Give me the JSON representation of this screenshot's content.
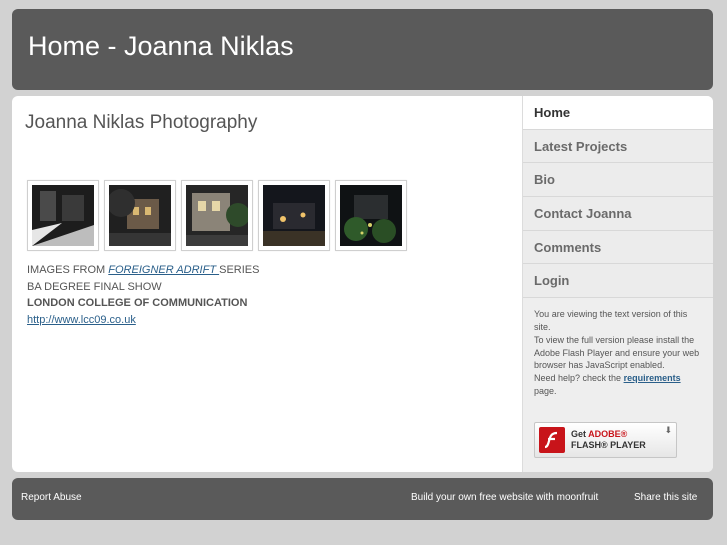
{
  "header": {
    "title": "Home - Joanna Niklas"
  },
  "main": {
    "heading": "Joanna Niklas Photography",
    "thumbnails": [
      {
        "name": "snowy street at night"
      },
      {
        "name": "house with dark trees"
      },
      {
        "name": "lit window facade"
      },
      {
        "name": "night street with lights"
      },
      {
        "name": "garden at night"
      }
    ],
    "caption": {
      "prefix": "IMAGES FROM ",
      "series_link": "FOREIGNER ADRIFT ",
      "suffix": "SERIES",
      "line2": "BA DEGREE FINAL SHOW",
      "line3": "LONDON COLLEGE OF COMMUNICATION",
      "url": "http://www.lcc09.co.uk"
    }
  },
  "sidebar": {
    "items": [
      {
        "label": "Home",
        "active": true
      },
      {
        "label": "Latest Projects"
      },
      {
        "label": "Bio"
      },
      {
        "label": "Contact Joanna"
      },
      {
        "label": "Comments"
      },
      {
        "label": "Login"
      }
    ],
    "notice": {
      "line1": "You are viewing the text version of this site.",
      "line2": "To view the full version please install the Adobe Flash Player and ensure your web browser has JavaScript enabled.",
      "line3_prefix": "Need help? check the ",
      "requirements_link": "requirements",
      "line3_suffix": " page."
    },
    "flash_button": {
      "line1_prefix": "Get ",
      "line1_brand": "ADOBE®",
      "line2": "FLASH® PLAYER"
    }
  },
  "footer": {
    "report": "Report Abuse",
    "build": "Build your own free website with moonfruit",
    "share": "Share this site"
  }
}
